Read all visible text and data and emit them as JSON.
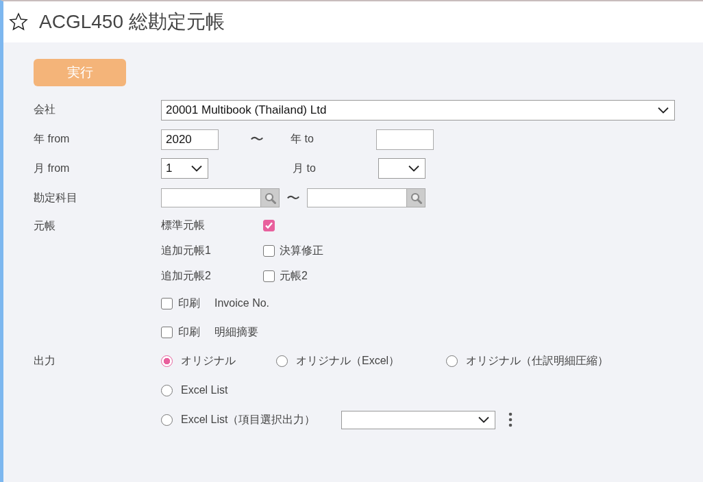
{
  "header": {
    "favorite": false,
    "title": "ACGL450 総勘定元帳"
  },
  "run_button": "実行",
  "company": {
    "label": "会社",
    "value": "20001 Multibook (Thailand) Ltd"
  },
  "year": {
    "from_label": "年 from",
    "from_value": "2020",
    "separator": "〜",
    "to_label": "年 to"
  },
  "month": {
    "from_label": "月 from",
    "from_value": "1",
    "to_label": "月 to"
  },
  "account": {
    "label": "勘定科目",
    "separator": "〜"
  },
  "ledger": {
    "label": "元帳",
    "items": [
      {
        "name": "標準元帳",
        "checked": true
      },
      {
        "name": "追加元帳1",
        "checkbox_label": "決算修正",
        "checked": false
      },
      {
        "name": "追加元帳2",
        "checkbox_label": "元帳2",
        "checked": false
      }
    ]
  },
  "print_options": [
    {
      "label": "印刷",
      "target": "Invoice No.",
      "checked": false
    },
    {
      "label": "印刷",
      "target": "明細摘要",
      "checked": false
    }
  ],
  "output": {
    "label": "出力",
    "options": [
      {
        "label": "オリジナル",
        "selected": true,
        "kind": "radio"
      },
      {
        "label": "オリジナル（Excel）",
        "selected": false,
        "kind": "radio"
      },
      {
        "label": "オリジナル（仕訳明細圧縮）",
        "selected": false,
        "kind": "radio"
      },
      {
        "label": "Excel List",
        "selected": false,
        "kind": "radio"
      },
      {
        "label": "Excel List（項目選択出力）",
        "selected": false,
        "kind": "radio_select"
      }
    ]
  }
}
